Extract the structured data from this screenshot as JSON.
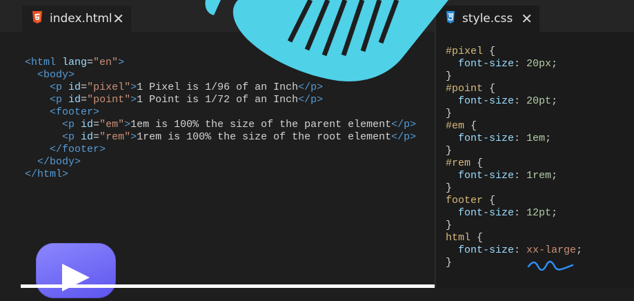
{
  "left_tab": {
    "title": "index.html",
    "icon": "html5-icon",
    "close": "✕"
  },
  "right_tab": {
    "title": "style.css",
    "icon": "css-file-icon",
    "close": "✕"
  },
  "html_code": {
    "l1": {
      "open": "<html",
      "attr": " lang",
      "eq": "=",
      "val": "\"en\"",
      "close": ">"
    },
    "l2": "<body>",
    "l3": {
      "open": "<p",
      "attr": " id",
      "eq": "=",
      "val": "\"pixel\"",
      "close": ">",
      "text": "1 Pixel is 1/96 of an Inch",
      "end": "</p>"
    },
    "l4": {
      "open": "<p",
      "attr": " id",
      "eq": "=",
      "val": "\"point\"",
      "close": ">",
      "text": "1 Point is 1/72 of an Inch",
      "end": "</p>"
    },
    "l5": "<footer>",
    "l6": {
      "open": "<p",
      "attr": " id",
      "eq": "=",
      "val": "\"em\"",
      "close": ">",
      "text": "1em is 100% the size of the parent element",
      "end": "</p>"
    },
    "l7": {
      "open": "<p",
      "attr": " id",
      "eq": "=",
      "val": "\"rem\"",
      "close": ">",
      "text": "1rem is 100% the size of the root element",
      "end": "</p>"
    },
    "l8": "</footer>",
    "l9": "</body>",
    "l10": "</html>"
  },
  "css_code": {
    "r1": {
      "selector": "#pixel",
      "prop": "font-size",
      "value": "20px"
    },
    "r2": {
      "selector": "#point",
      "prop": "font-size",
      "value": "20pt"
    },
    "r3": {
      "selector": "#em",
      "prop": "font-size",
      "value": "1em"
    },
    "r4": {
      "selector": "#rem",
      "prop": "font-size",
      "value": "1rem"
    },
    "r5": {
      "selector": "footer",
      "prop": "font-size",
      "value": "12pt"
    },
    "r6": {
      "selector": "html",
      "prop": "font-size",
      "value": "xx-large"
    }
  },
  "colors": {
    "accent_blob": "#4fd1e8",
    "play_button": "#6c66f5",
    "html_icon": "#e34c26",
    "css_icon": "#2a8ad6"
  }
}
